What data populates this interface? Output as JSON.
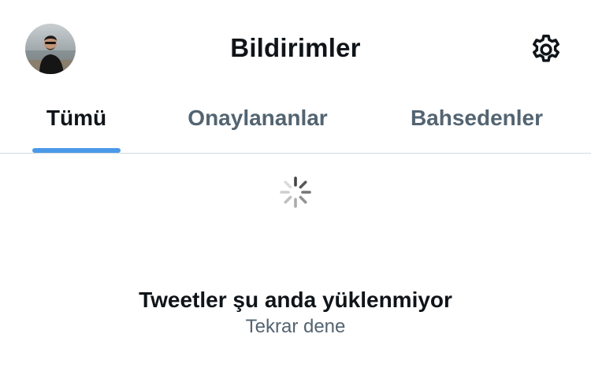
{
  "header": {
    "title": "Bildirimler",
    "avatar_icon": "user-avatar-photo",
    "settings_icon": "gear-icon"
  },
  "tabs": [
    {
      "label": "Tümü",
      "active": true
    },
    {
      "label": "Onaylananlar",
      "active": false
    },
    {
      "label": "Bahsedenler",
      "active": false
    }
  ],
  "status": {
    "loading_icon": "spinner-icon",
    "message": "Tweetler şu anda yüklenmiyor",
    "retry_label": "Tekrar dene"
  },
  "colors": {
    "accent": "#4a99e9",
    "text_primary": "#0f1419",
    "text_secondary": "#536471",
    "divider": "#d6dbdf"
  }
}
